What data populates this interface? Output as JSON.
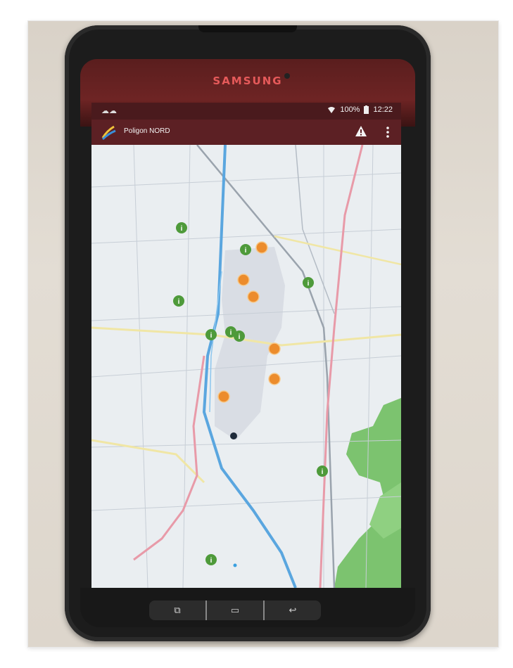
{
  "device": {
    "brand": "SAMSUNG"
  },
  "status_bar": {
    "notifications": "☁☁",
    "battery": "100%",
    "time": "12:22"
  },
  "app_bar": {
    "title": "Poligon NORD"
  },
  "colors": {
    "app_bar": "#5c2024",
    "status_bar": "#4a1a1d",
    "marker_green": "#4e9a3a",
    "marker_orange": "#ec8c2c",
    "river": "#5aa6df",
    "road_pink": "#e89aa8",
    "forest": "#6fbe6a"
  },
  "map": {
    "marker_types": [
      "info-marker-green",
      "warning-marker-orange",
      "location-dot"
    ]
  },
  "nav_keys": {
    "recent": "⧉",
    "home": "▭",
    "back": "↩"
  }
}
